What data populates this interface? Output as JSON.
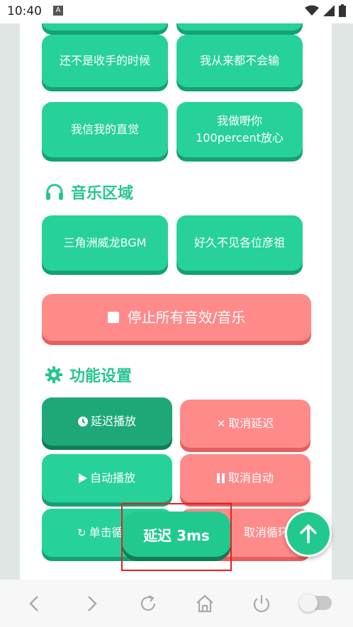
{
  "status": {
    "time": "10:40",
    "notif_icon": "A"
  },
  "sound_buttons": [
    {
      "label": "还不是收手的时候"
    },
    {
      "label": "我从来都不会输"
    },
    {
      "label": "我信我的直觉"
    },
    {
      "label_line1": "我做嘢你",
      "label_line2": "100percent放心"
    }
  ],
  "music_section": {
    "title": "音乐区域"
  },
  "music_buttons": [
    {
      "label": "三角洲威龙BGM"
    },
    {
      "label": "好久不见各位彦祖"
    }
  ],
  "stop_all": {
    "label": "停止所有音效/音乐"
  },
  "settings_section": {
    "title": "功能设置"
  },
  "settings_buttons": {
    "delay_play": "延迟播放",
    "cancel_delay": "取消延迟",
    "auto_play": "自动播放",
    "cancel_auto": "取消自动",
    "loop_play": "单击循",
    "cancel_loop": "取消循环"
  },
  "toast": {
    "text": "延迟 3ms"
  },
  "colors": {
    "accent": "#27d19a",
    "danger": "#ff8a8a"
  }
}
